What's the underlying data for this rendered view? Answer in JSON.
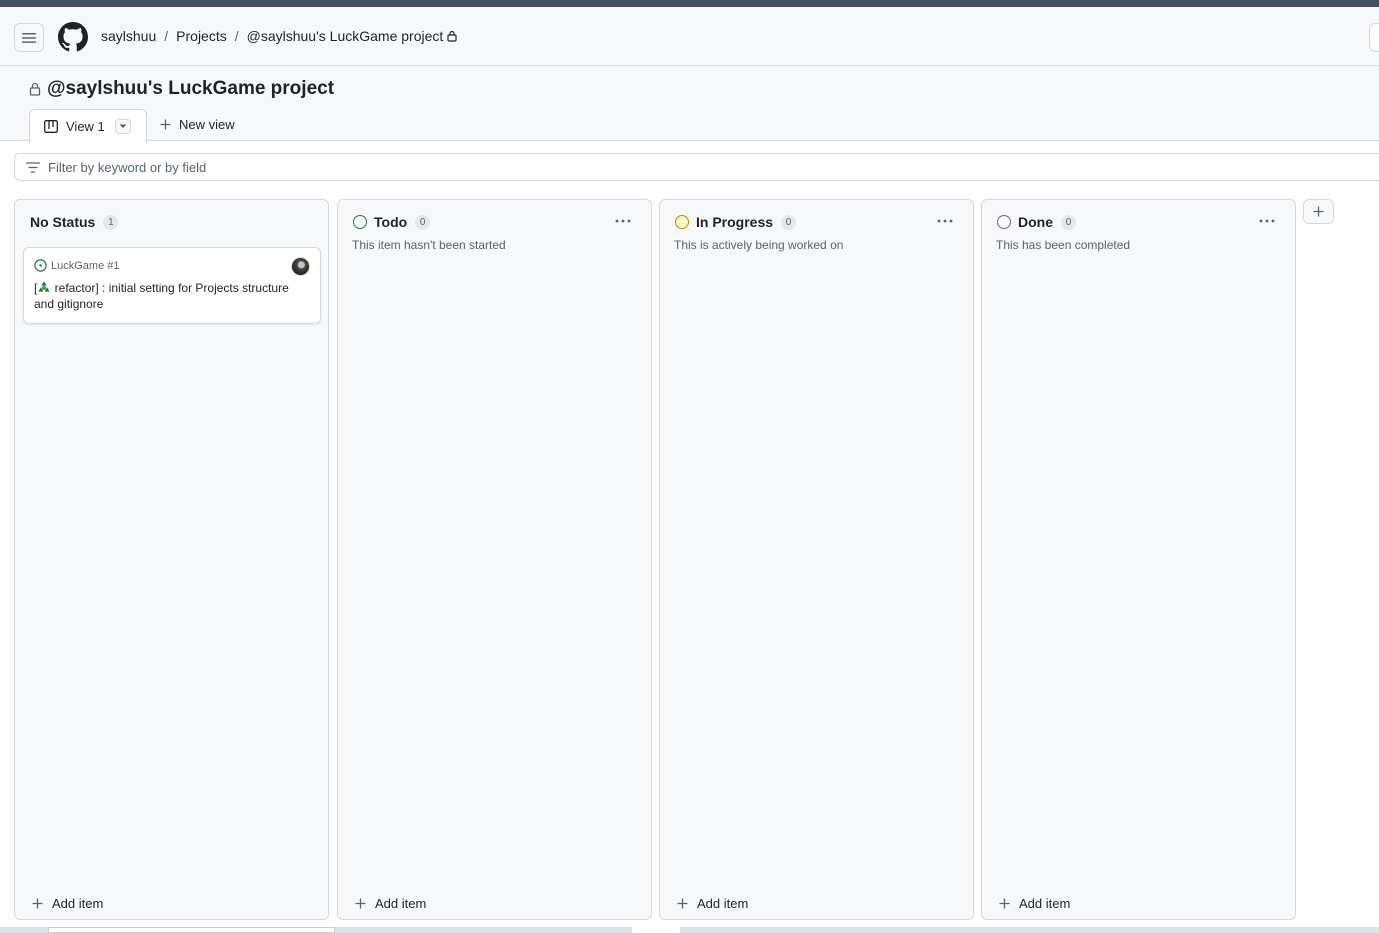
{
  "header": {
    "breadcrumbs": [
      "saylshuu",
      "Projects",
      "@saylshuu's LuckGame project"
    ],
    "separator": "/"
  },
  "project": {
    "title": "@saylshuu's LuckGame project"
  },
  "views": {
    "active_tab": "View 1",
    "new_view_label": "New view"
  },
  "filter": {
    "placeholder": "Filter by keyword or by field"
  },
  "columns": [
    {
      "name": "No Status",
      "count": "1",
      "description": "",
      "status_color": "",
      "add_item_label": "Add item",
      "cards": [
        {
          "repo_ref": "LuckGame #1",
          "title_prefix": "[",
          "emoji": "recycle-icon",
          "title": " refactor] : initial setting for Projects structure and gitignore"
        }
      ]
    },
    {
      "name": "Todo",
      "count": "0",
      "description": "This item hasn't been started",
      "status_color": "#1a7f37",
      "add_item_label": "Add item"
    },
    {
      "name": "In Progress",
      "count": "0",
      "description": "This is actively being worked on",
      "status_color": "#bf8700",
      "add_item_label": "Add item"
    },
    {
      "name": "Done",
      "count": "0",
      "description": "This has been completed",
      "status_color": "#8250df",
      "add_item_label": "Add item"
    }
  ],
  "colors": {
    "accent_open": "#1a7f37",
    "border": "#d1d9e0",
    "canvas_subtle": "#f6f8fa"
  }
}
